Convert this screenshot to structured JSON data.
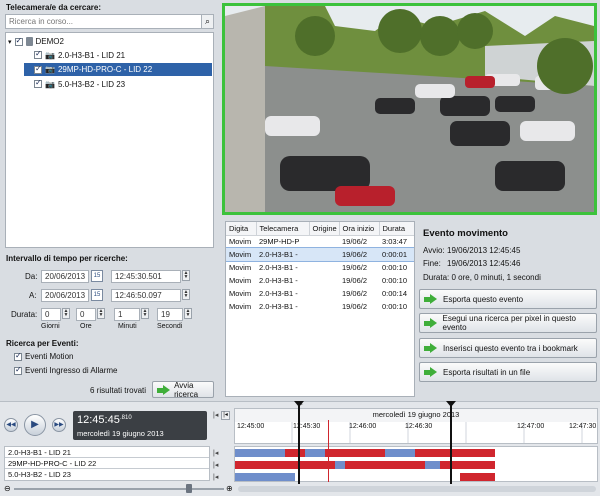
{
  "search": {
    "title": "Telecamera/e da cercare:",
    "placeholder": "Ricerca in corso...",
    "icon": "search-icon"
  },
  "tree": {
    "root": "DEMO2",
    "cameras": [
      {
        "label": "2.0-H3-B1 - LID 21",
        "checked": true,
        "selected": false
      },
      {
        "label": "29MP-HD-PRO-C - LID 22",
        "checked": true,
        "selected": true
      },
      {
        "label": "5.0-H3-B2 - LID 23",
        "checked": true,
        "selected": false
      }
    ]
  },
  "time": {
    "title": "Intervallo di tempo per ricerche:",
    "from_label": "Da:",
    "from_date": "20/06/2013",
    "from_time": "12:45:30.501",
    "to_label": "A:",
    "to_date": "20/06/2013",
    "to_time": "12:46:50.097",
    "duration_label": "Durata:",
    "duration": [
      "0",
      "0",
      "1",
      "19"
    ],
    "units": [
      "Giorni",
      "Ore",
      "Minuti",
      "Secondi"
    ],
    "cal_day": "15"
  },
  "events": {
    "title": "Ricerca per Eventi:",
    "motion": "Eventi Motion",
    "alarm": "Eventi Ingresso di Allarme"
  },
  "results": {
    "count_text": "6  risultati trovati",
    "start_button": "Avvia ricerca"
  },
  "table": {
    "headers": [
      "Digita",
      "Telecamera",
      "Origine",
      "Ora inizio",
      "Durata"
    ],
    "rows": [
      [
        "Movim",
        "29MP-HD-P",
        "",
        "19/06/2",
        "3:03:47"
      ],
      [
        "Movim",
        "2.0-H3-B1 -",
        "",
        "19/06/2",
        "0:00:01"
      ],
      [
        "Movim",
        "2.0-H3-B1 -",
        "",
        "19/06/2",
        "0:00:10"
      ],
      [
        "Movim",
        "2.0-H3-B1 -",
        "",
        "19/06/2",
        "0:00:10"
      ],
      [
        "Movim",
        "2.0-H3-B1 -",
        "",
        "19/06/2",
        "0:00:14"
      ],
      [
        "Movim",
        "2.0-H3-B1 -",
        "",
        "19/06/2",
        "0:00:10"
      ]
    ],
    "selected_row": 1
  },
  "event": {
    "title": "Evento movimento",
    "start_label": "Avvio:",
    "start_value": "19/06/2013 12:45:45",
    "end_label": "Fine:",
    "end_value": "19/06/2013 12:45:46",
    "duration_text": "Durata: 0 ore, 0 minuti, 1 secondi",
    "actions": [
      "Esporta questo evento",
      "Esegui una ricerca per pixel in questo evento",
      "Inserisci questo evento tra i bookmark",
      "Esporta risultati in un file"
    ]
  },
  "player": {
    "time": "12:45:45",
    "ms": ".810",
    "date": "mercoledì 19 giugno 2013"
  },
  "timeline": {
    "date_label": "mercoledì 19 giugno 2013",
    "ticks": [
      "12:45:00",
      "12:45:30",
      "12:46:00",
      "12:46:30",
      "12:47:00",
      "12:47:30"
    ],
    "tracks": [
      "2.0-H3-B1 - LID 21",
      "29MP-HD-PRO-C - LID 22",
      "5.0-H3-B2 - LID 23"
    ]
  },
  "colors": {
    "accent": "#2e62a8",
    "video_border": "#3cc23c",
    "track_red": "#d0262e",
    "track_blue": "#6f8ecb",
    "button_green": "#3fae3a"
  }
}
